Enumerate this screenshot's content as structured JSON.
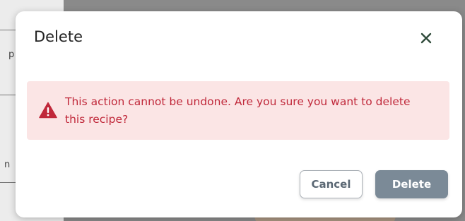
{
  "dialog": {
    "title": "Delete",
    "close_icon": "close-icon",
    "alert": {
      "icon": "warning-triangle-icon",
      "message": "This action cannot be undone. Are you sure you want to delete this recipe?",
      "text_color": "#c0283a",
      "background_color": "#fbe5e5"
    },
    "buttons": {
      "cancel_label": "Cancel",
      "delete_label": "Delete",
      "delete_color": "#7b8a97"
    }
  },
  "background": {
    "partial_chars": [
      "p",
      "n"
    ]
  }
}
